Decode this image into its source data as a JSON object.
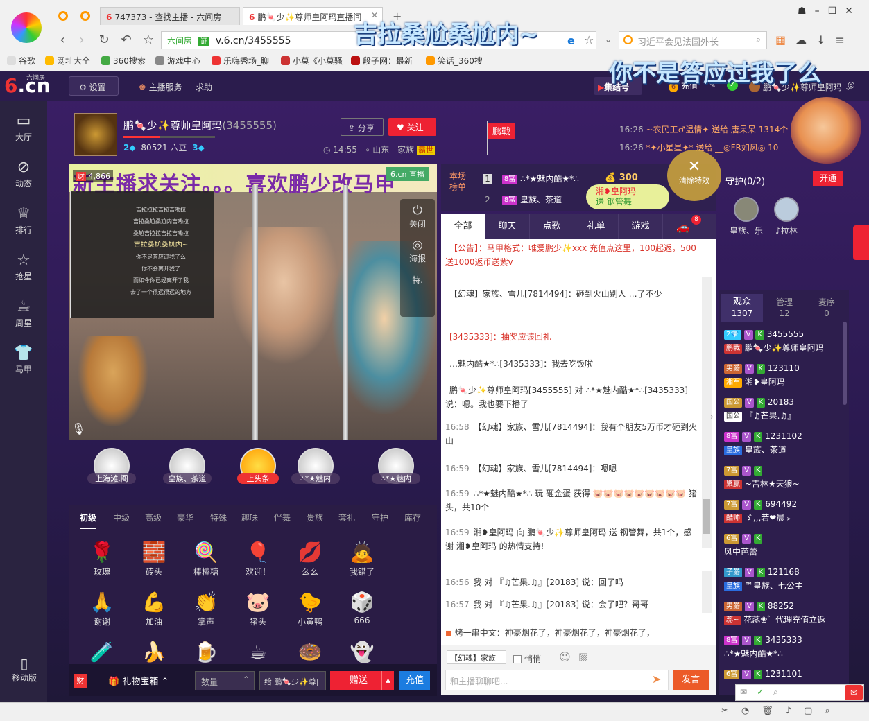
{
  "browser": {
    "tabs": [
      "747373 - 查找主播 - 六间房",
      "鹏🍬少✨尊师皇阿玛直播间"
    ],
    "address": "v.6.cn/3455555",
    "address_site": "六间房",
    "address_cert": "证",
    "search_placeholder": "习近平会见法国外长",
    "bookmarks": [
      "谷歌",
      "网址大全",
      "360搜索",
      "游戏中心",
      "乐嗨秀场_聊",
      "小莫《小莫骚",
      "段子网：最新",
      "笑话_360搜"
    ]
  },
  "overlay": {
    "line1": "吉拉桑尬桑尬内~",
    "line2": "你不是答应过我了么"
  },
  "site": {
    "logo": "6.cn",
    "logo_sub": "六间房",
    "settings": "设置",
    "anchor_service": "主播服务",
    "help": "求助",
    "gather": "集结号",
    "recharge": "充值",
    "user": "鹏🍬少✨尊师皇阿玛",
    "leftnav": [
      "大厅",
      "动态",
      "排行",
      "抢星",
      "周星",
      "马甲"
    ],
    "mobile": "移动版"
  },
  "anchor": {
    "name": "鹏🍬少✨尊师皇阿玛",
    "id": "(3455555)",
    "beans": "80521 六豆",
    "share": "分享",
    "follow": "关注",
    "time": "14:55",
    "location": "山东",
    "family": "家族",
    "family_badge": "霸世",
    "flag": "鹏戰",
    "lv_left": "2",
    "lv_right": "3"
  },
  "ticker": [
    {
      "time": "16:26",
      "text": "~农民工♂温情✦ 送给 唐呆呆 1314个"
    },
    {
      "time": "16:26",
      "text": "*✦小星星✦* 送给 __◎FR如风◎ 10"
    }
  ],
  "video": {
    "wealth": "4,866",
    "banner": "新主播求关注。。。喜欢鹏少改马甲",
    "brand": "6.cn 直播",
    "close": "关闭",
    "poster": "海报",
    "special": "特.",
    "lyrics": [
      "吉拉拉拉吉拉吉嘞拉",
      "吉拉桑尬桑尬内吉嘞拉",
      "桑尬吉拉拉吉拉吉嘞拉",
      "吉拉桑尬桑尬内~",
      "你不是答应过我了么",
      "你不会离开我了",
      "而如今你已经离开了我",
      "去了一个很远很远的地方"
    ]
  },
  "seats": [
    "上海滩.阁",
    "皇族、茶道",
    "上头条",
    "∴*★魅内",
    "∴*★魅内"
  ],
  "gift_tabs": [
    "初级",
    "中级",
    "高级",
    "豪华",
    "特殊",
    "趣味",
    "伴舞",
    "贵族",
    "套礼",
    "守护",
    "库存"
  ],
  "gifts": [
    "玫瑰",
    "砖头",
    "棒棒糖",
    "欢迎！",
    "么么",
    "我错了",
    "谢谢",
    "加油",
    "掌声",
    "猪头",
    "小黄鸭",
    "666"
  ],
  "gift_bar": {
    "bag": "礼物宝箱",
    "qty_placeholder": "数量",
    "to": "给 鹏🍬少✨尊|",
    "send": "赠送",
    "recharge": "充值",
    "wealth_icon": "财"
  },
  "rank": {
    "label": "本场榜单",
    "rows": [
      {
        "no": "1",
        "lv": "8富",
        "name": "∴*★魅内酷★*∴",
        "coins": "300"
      },
      {
        "no": "2",
        "lv": "8富",
        "name": "皇族、茶道"
      }
    ],
    "guard": "守护(0/2)",
    "open": "开通",
    "guards": [
      "皇族、乐",
      "♪拉林"
    ],
    "clear": "清除特效",
    "gift_popup": {
      "from": "湘❥皇阿玛",
      "text": "送 钢管舞"
    }
  },
  "chat_tabs": [
    "全部",
    "聊天",
    "点歌",
    "礼单",
    "游戏"
  ],
  "car_badge": "8",
  "chat": [
    {
      "time": "",
      "text": "【公告】：马甲格式：唯爱鹏少✨xxx 充值点这里，100起返，500 送1000返币送紫v"
    },
    {
      "time": "",
      "text": "【幻魂】家族、雪儿[7814494]：砸到火山别人 …了不少"
    },
    {
      "time": "",
      "text": "[3435333]：抽奖应该回礼"
    },
    {
      "time": "",
      "text": "…魅内酷★*∴[3435333]：我去吃饭啦"
    },
    {
      "time": "",
      "text": "鹏🍬少✨尊师皇阿玛[3455555] 对 ∴*★魅内酷★*∴[3435333] 说：嗯。我也要下播了"
    },
    {
      "time": "16:58",
      "text": "【幻魂】家族、雪儿[7814494]：我有个朋友5万币才砸到火山"
    },
    {
      "time": "16:59",
      "text": "【幻魂】家族、雪儿[7814494]：嗯嗯"
    },
    {
      "time": "16:59",
      "text": "∴*★魅内酷★*∴ 玩 砸金蛋 获得 🐷🐷🐷🐷🐷🐷🐷🐷🐷 猪头，共10个"
    },
    {
      "time": "16:59",
      "text": "湘❥皇阿玛 向 鹏🍬少✨尊师皇阿玛 送 钢管舞，共1个，感谢 湘❥皇阿玛 的热情支持!"
    }
  ],
  "private_chat": [
    {
      "time": "16:56",
      "text": "我 对 『♫芒果.♫』[20183] 说：回了吗"
    },
    {
      "time": "16:57",
      "text": "我 对 『♫芒果.♫』[20183] 说：会了吧？哥哥"
    }
  ],
  "marquee": "烤一串中文：神豪烟花了，神豪烟花了，神豪烟花了，",
  "chat_input": {
    "family": "【幻魂】家族",
    "whisper": "悄悄",
    "placeholder": "和主播聊聊吧...",
    "send": "发言"
  },
  "audience": {
    "tabs": [
      {
        "label": "观众",
        "count": "1307"
      },
      {
        "label": "管理",
        "count": "12"
      },
      {
        "label": "麦序",
        "count": "0"
      }
    ],
    "rows": [
      {
        "id": "3455555",
        "name": "鹏🍬少✨尊师皇阿玛",
        "badge": "鹏戰"
      },
      {
        "id": "123110",
        "name": "湘❥皇阿玛",
        "badge": "湘军"
      },
      {
        "id": "20183",
        "name": "『♫芒果.♫』",
        "badge": "国公"
      },
      {
        "id": "1231102",
        "name": "皇族、茶道",
        "badge": "皇族"
      },
      {
        "id": "",
        "name": "~吉林★天狼~",
        "badge": "聚赢"
      },
      {
        "id": "694492",
        "name": "ゞ,,,若❤晨﹥",
        "badge": "酷帅"
      },
      {
        "id": "",
        "name": "风中芭蕾",
        "badge": ""
      },
      {
        "id": "121168",
        "name": "™皇族、七公主",
        "badge": "皇族"
      },
      {
        "id": "88252",
        "name": "花蕊❀゛代理充值立返",
        "badge": "蕊~"
      },
      {
        "id": "3435333",
        "name": "∴*★魅内酷★*∴",
        "badge": ""
      },
      {
        "id": "1231101",
        "name": "",
        "badge": ""
      }
    ]
  }
}
